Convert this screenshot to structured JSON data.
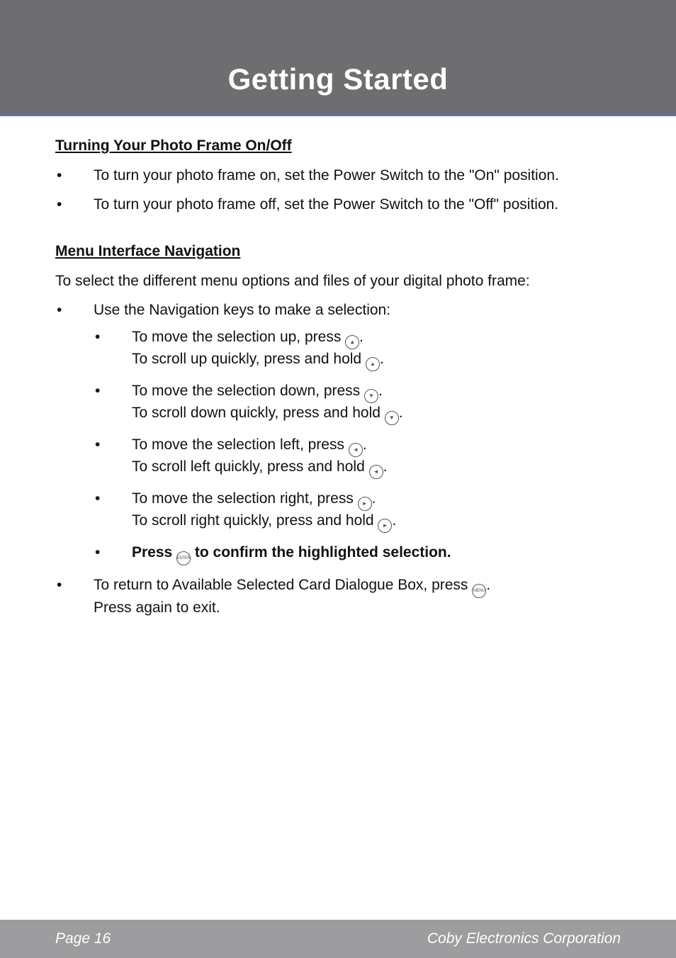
{
  "header": {
    "title": "Getting Started"
  },
  "section1": {
    "heading": "Turning Your Photo Frame On/Off",
    "items": [
      "To turn your photo frame on, set the Power Switch to the \"On\" position.",
      "To turn your photo frame off, set the Power Switch to the \"Off\" position."
    ]
  },
  "section2": {
    "heading": "Menu Interface Navigation",
    "intro": "To select the different menu options and files of your digital photo frame:",
    "nav_intro": "Use the Navigation keys to make a selection:",
    "nav_items": {
      "up": {
        "l1a": "To move the selection up, press ",
        "l1b": ".",
        "l2a": "To scroll up quickly, press and hold ",
        "l2b": "."
      },
      "down": {
        "l1a": "To move the selection down, press ",
        "l1b": ".",
        "l2a": "To scroll down quickly, press and hold ",
        "l2b": "."
      },
      "left": {
        "l1a": "To move the selection left, press ",
        "l1b": ".",
        "l2a": "To scroll left quickly, press and hold ",
        "l2b": "."
      },
      "right": {
        "l1a": "To move the selection right, press ",
        "l1b": ".",
        "l2a": "To scroll right quickly, press and hold ",
        "l2b": "."
      },
      "confirm": {
        "pre": "Press ",
        "post": " to confirm the highlighted selection."
      }
    },
    "return_item": {
      "l1a": "To return to Available Selected Card Dialogue Box, press ",
      "l1b": ".",
      "l2": "Press again to exit."
    }
  },
  "icons": {
    "up": "▲",
    "down": "▼",
    "left": "◄",
    "right": "►",
    "enter": "ENTER",
    "menu": "MENU"
  },
  "footer": {
    "left": "Page 16",
    "right": "Coby Electronics Corporation"
  }
}
